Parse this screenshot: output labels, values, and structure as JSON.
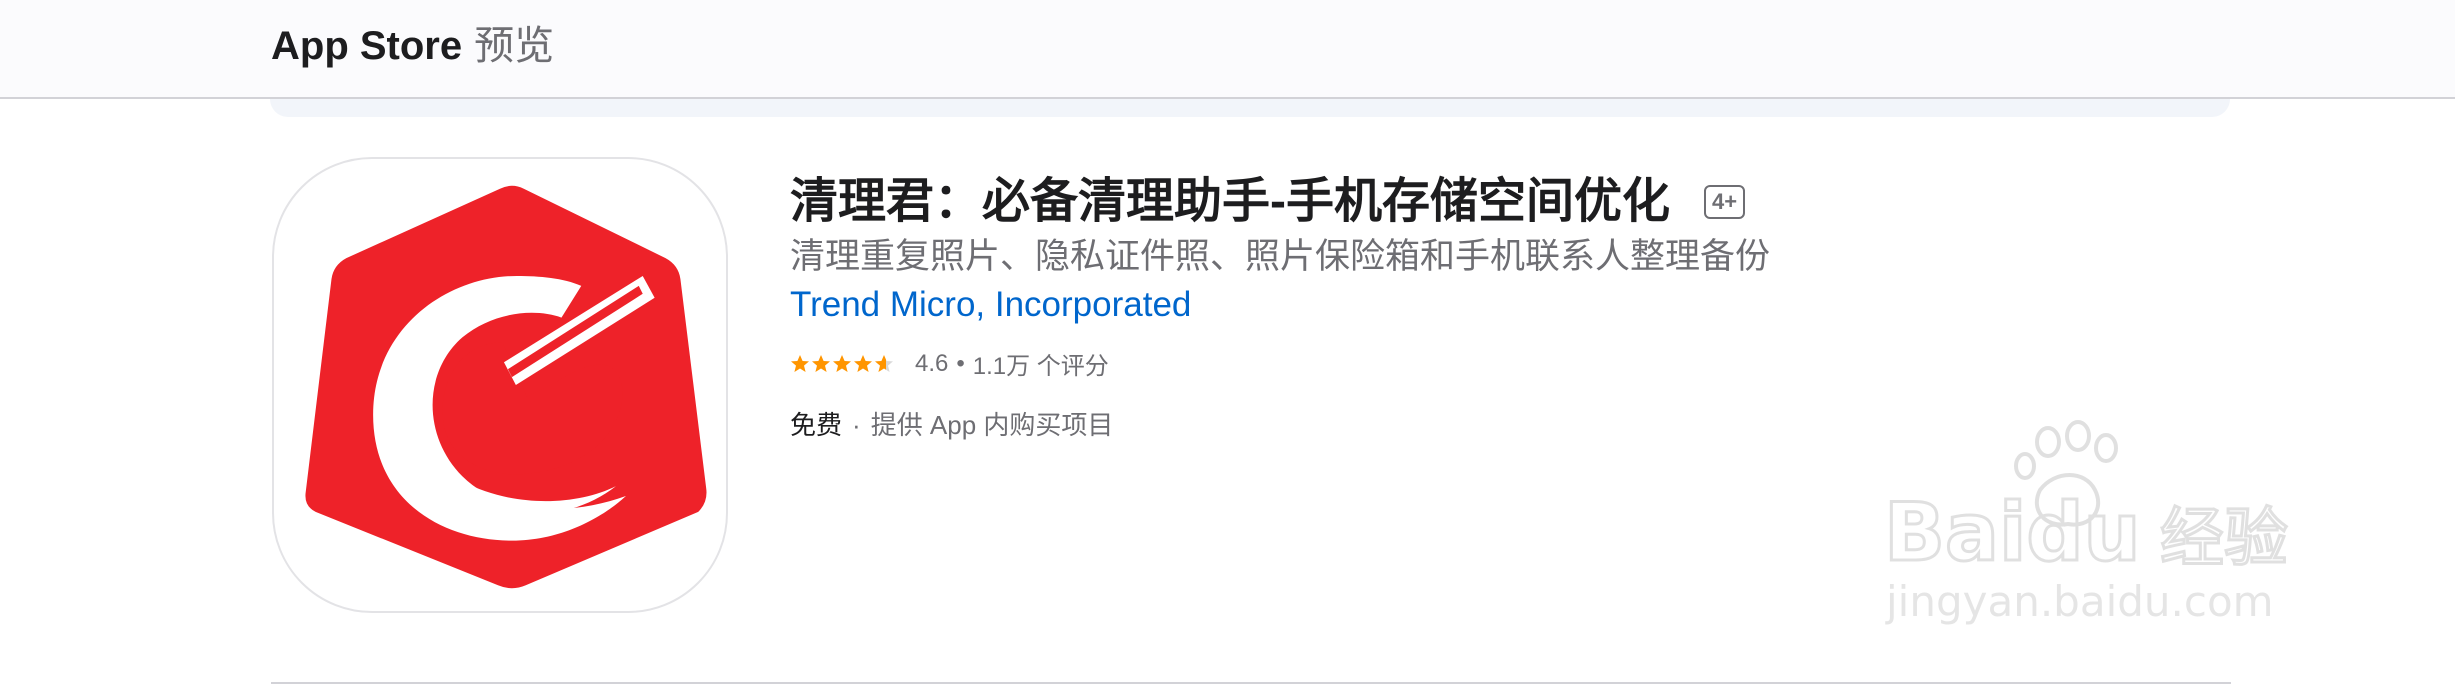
{
  "header": {
    "brand": "App Store",
    "section": "预览"
  },
  "app": {
    "title": "清理君：必备清理助手-手机存储空间优化",
    "age_rating": "4+",
    "subtitle": "清理重复照片、隐私证件照、照片保险箱和手机联系人整理备份",
    "developer": "Trend Micro, Incorporated",
    "rating": {
      "value": "4.6",
      "stars": 4.6,
      "separator": "•",
      "count": "1.1万 个评分"
    },
    "price": {
      "label": "免费",
      "separator": "·",
      "iap_note": "提供 App 内购买项目"
    },
    "icon": {
      "name": "cleaner-app-icon",
      "primary_color": "#ee2229",
      "background_color": "#ffffff"
    }
  },
  "watermark": {
    "logo_text": "Baidu",
    "logo_cn": "经验",
    "url": "jingyan.baidu.com"
  },
  "colors": {
    "link": "#0066cc",
    "secondary_text": "#6e6e73",
    "star": "#ff9500"
  }
}
